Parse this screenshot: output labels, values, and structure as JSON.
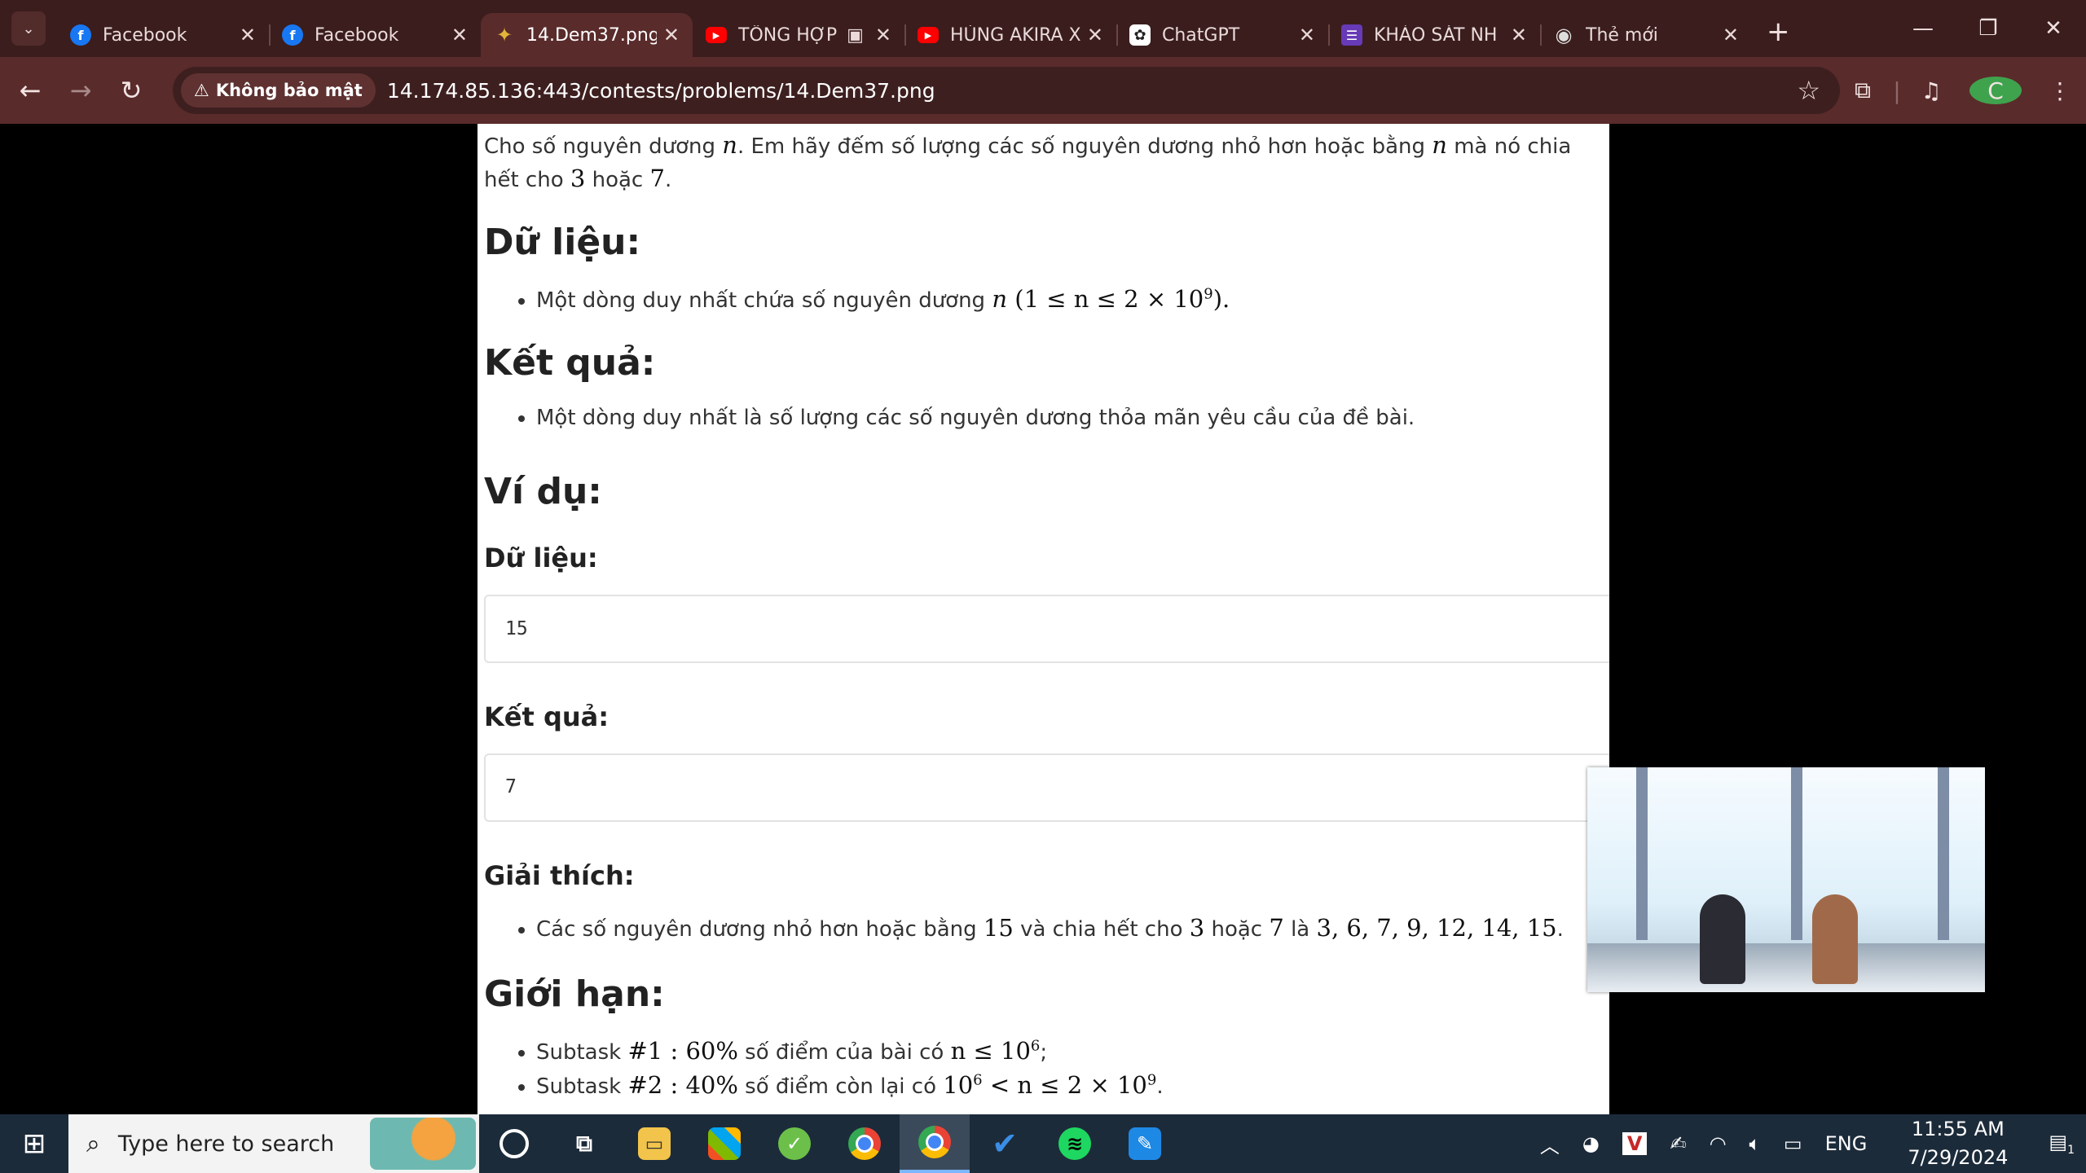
{
  "browser": {
    "tabs": [
      {
        "title": "Facebook",
        "icon": "facebook-icon",
        "color": "#1877f2",
        "glyph": "f"
      },
      {
        "title": "Facebook",
        "icon": "facebook-icon",
        "color": "#1877f2",
        "glyph": "f"
      },
      {
        "title": "14.Dem37.png",
        "icon": "bird-icon",
        "color": "#c8a12a",
        "glyph": "✦",
        "active": true
      },
      {
        "title": "TỔNG HỢP",
        "icon": "youtube-icon",
        "color": "#ff0000",
        "glyph": "▶",
        "extra": "▣"
      },
      {
        "title": "HÙNG AKIRA X",
        "icon": "youtube-icon",
        "color": "#ff0000",
        "glyph": "▶"
      },
      {
        "title": "ChatGPT",
        "icon": "chatgpt-icon",
        "color": "#ffffff",
        "glyph": "✿"
      },
      {
        "title": "KHẢO SÁT NH",
        "icon": "forms-icon",
        "color": "#673ab7",
        "glyph": "☰"
      },
      {
        "title": "Thẻ mới",
        "icon": "chrome-icon",
        "color": "#cfcfcf",
        "glyph": "◉"
      }
    ],
    "security_label": "Không bảo mật",
    "url": "14.174.85.136:443/contests/problems/14.Dem37.png",
    "profile_initial": "C"
  },
  "problem": {
    "intro": {
      "p1": "Cho số nguyên dương ",
      "n1": "n",
      "p2": ". Em hãy đếm số lượng các số nguyên dương nhỏ hơn hoặc bằng ",
      "n2": "n",
      "p3": " mà nó chia hết cho ",
      "a": "3",
      "p4": " hoặc ",
      "b": "7",
      "p5": "."
    },
    "input_heading": "Dữ liệu:",
    "input_item": {
      "text": "Một dòng duy nhất chứa số nguyên dương ",
      "var": "n",
      "constraint": "(1 ≤ n ≤ 2 × 10",
      "exp": "9",
      "end": ")."
    },
    "output_heading": "Kết quả:",
    "output_item": "Một dòng duy nhất là số lượng các số nguyên dương thỏa mãn yêu cầu của đề bài.",
    "example_heading": "Ví dụ:",
    "example_input_label": "Dữ liệu:",
    "example_input": "15",
    "example_output_label": "Kết quả:",
    "example_output": "7",
    "explain_label": "Giải thích:",
    "explain_item": {
      "t1": "Các số nguyên dương nhỏ hơn hoặc bằng ",
      "n": "15",
      "t2": " và chia hết cho ",
      "a": "3",
      "t3": " hoặc ",
      "b": "7",
      "t4": " là ",
      "list": "3, 6, 7, 9, 12, 14, 15",
      "end": "."
    },
    "limits_heading": "Giới hạn:",
    "limits": [
      {
        "label": "Subtask ",
        "id": "#1 : 60%",
        "text": " số điểm của bài có ",
        "math": "n ≤ 10",
        "exp": "6",
        "end": ";"
      },
      {
        "label": "Subtask ",
        "id": "#2 : 40%",
        "text": " số điểm còn lại có ",
        "math": "10",
        "exp": "6",
        "math2": " < n ≤ 2 × 10",
        "exp2": "9",
        "end": "."
      }
    ]
  },
  "taskbar": {
    "search_placeholder": "Type here to search",
    "apps": [
      "cortana-icon",
      "task-view-icon",
      "file-explorer-icon",
      "store-icon",
      "greenshot-icon",
      "chrome-icon",
      "chrome-profile-icon",
      "todo-icon",
      "spotify-icon",
      "photo-editor-icon"
    ],
    "lang": "ENG",
    "time": "11:55 AM",
    "date": "7/29/2024",
    "notification_count": "1"
  }
}
